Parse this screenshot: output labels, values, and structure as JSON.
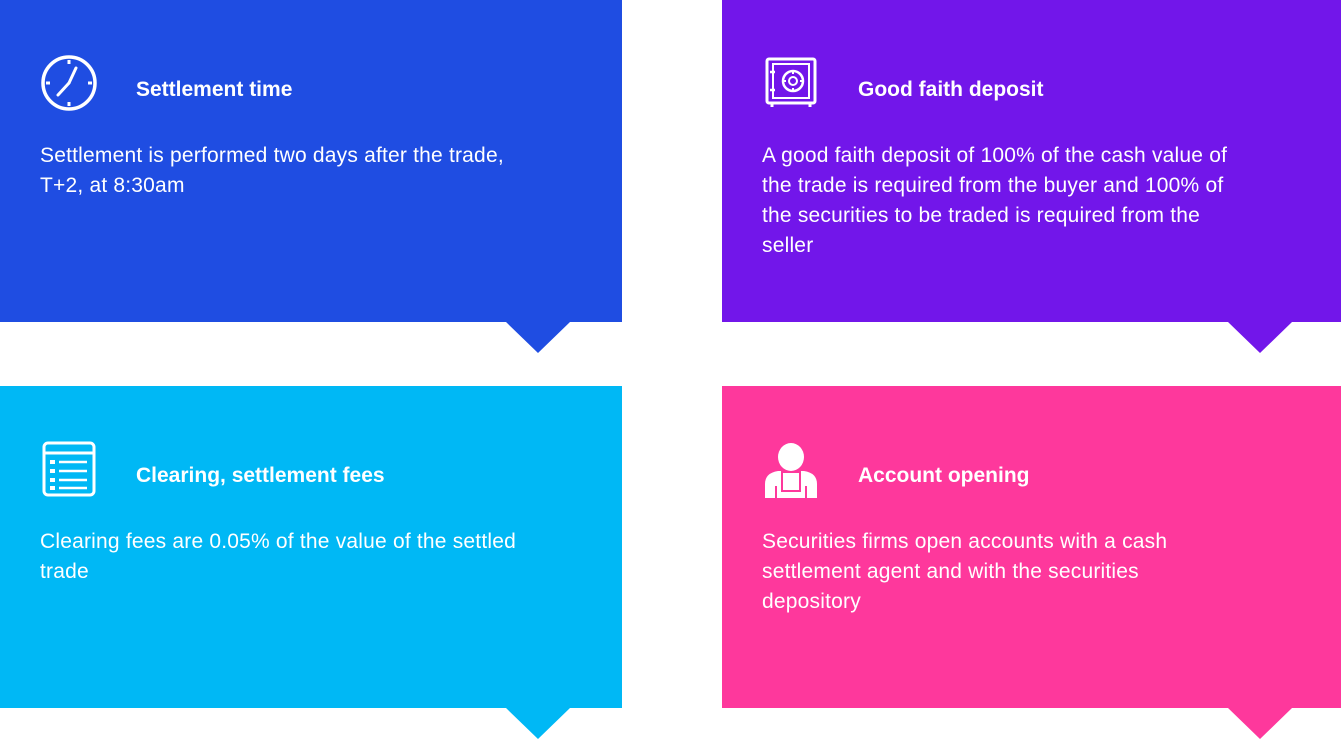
{
  "cards": [
    {
      "title": "Settlement time",
      "body": "Settlement is performed two days after the trade, T+2, at 8:30am",
      "icon": "clock-icon",
      "color": "#1f4de2"
    },
    {
      "title": "Good faith deposit",
      "body": "A good faith deposit of 100% of the cash value of the trade is required from the buyer and 100% of the securities to be traded is required from the seller",
      "icon": "safe-icon",
      "color": "#7216ea"
    },
    {
      "title": "Clearing, settlement fees",
      "body": "Clearing fees are 0.05% of the value of the settled trade",
      "icon": "checklist-icon",
      "color": "#00b8f5"
    },
    {
      "title": "Account opening",
      "body": "Securities firms open accounts with a cash settlement agent and with the securities depository",
      "icon": "person-icon",
      "color": "#fe389c"
    }
  ]
}
